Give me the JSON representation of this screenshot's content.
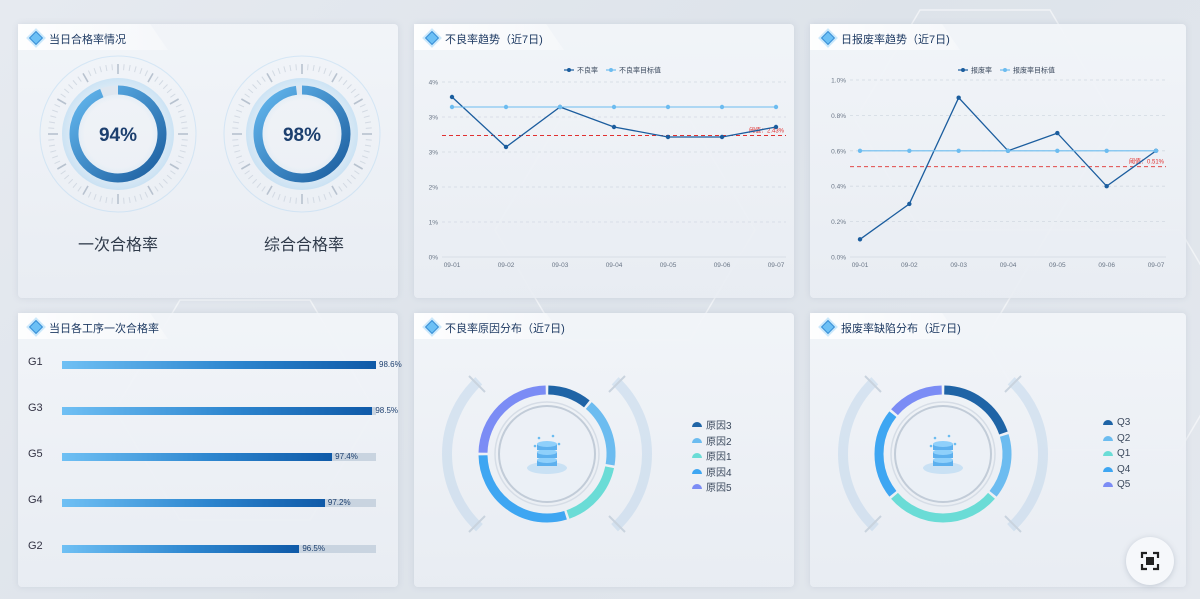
{
  "colors": {
    "dark_blue": "#1b5d9e",
    "light_blue": "#6cbcf0",
    "threshold_red": "#e03030",
    "pie": [
      "#1f64a6",
      "#6cbcf0",
      "#6adcd6",
      "#3ea6f2",
      "#7b8cf5"
    ]
  },
  "panels": {
    "pass_rate": {
      "title": "当日合格率情况",
      "gauges": [
        {
          "value_text": "94%",
          "value": 94,
          "label": "一次合格率"
        },
        {
          "value_text": "98%",
          "value": 98,
          "label": "综合合格率"
        }
      ]
    },
    "defect_trend": {
      "title": "不良率趋势（近7日)"
    },
    "scrap_trend": {
      "title": "日报废率趋势（近7日)"
    },
    "process_pass": {
      "title": "当日各工序一次合格率"
    },
    "defect_cause": {
      "title": "不良率原因分布（近7日)"
    },
    "scrap_defect": {
      "title": "报废率缺陷分布（近7日)"
    }
  },
  "chart_data": [
    {
      "type": "line",
      "x": [
        "09-01",
        "09-02",
        "09-03",
        "09-04",
        "09-05",
        "09-06",
        "09-07"
      ],
      "series": [
        {
          "name": "不良率",
          "values": [
            3.2,
            2.2,
            3.0,
            2.6,
            2.4,
            2.4,
            2.6
          ]
        },
        {
          "name": "不良率目标值",
          "values": [
            3.0,
            3.0,
            3.0,
            3.0,
            3.0,
            3.0,
            3.0
          ]
        }
      ],
      "yticks": [
        "0%",
        "1%",
        "2%",
        "3%",
        "3%",
        "4%"
      ],
      "ylim": [
        0,
        3.5
      ],
      "threshold": {
        "value": 2.43,
        "label": "阈值：2.43%"
      },
      "legend": "top-center"
    },
    {
      "type": "line",
      "x": [
        "09-01",
        "09-02",
        "09-03",
        "09-04",
        "09-05",
        "09-06",
        "09-07"
      ],
      "series": [
        {
          "name": "报废率",
          "values": [
            0.1,
            0.3,
            0.9,
            0.6,
            0.7,
            0.4,
            0.6
          ]
        },
        {
          "name": "报废率目标值",
          "values": [
            0.6,
            0.6,
            0.6,
            0.6,
            0.6,
            0.6,
            0.6
          ]
        }
      ],
      "yticks": [
        "0.0%",
        "0.2%",
        "0.4%",
        "0.6%",
        "0.8%",
        "1.0%"
      ],
      "ylim": [
        0,
        1.0
      ],
      "threshold": {
        "value": 0.51,
        "label": "阈值：0.51%"
      },
      "legend": "top-center"
    },
    {
      "type": "bar",
      "orientation": "horizontal",
      "categories": [
        "G1",
        "G3",
        "G5",
        "G4",
        "G2"
      ],
      "values": [
        98.6,
        98.5,
        97.4,
        97.2,
        96.5
      ],
      "value_labels": [
        "98.6%",
        "98.5%",
        "97.4%",
        "97.2%",
        "96.5%"
      ]
    },
    {
      "type": "pie",
      "categories": [
        "原因3",
        "原因2",
        "原因1",
        "原因4",
        "原因5"
      ],
      "values": [
        11,
        17,
        17,
        30,
        25
      ],
      "legend": "right"
    },
    {
      "type": "pie",
      "categories": [
        "Q3",
        "Q2",
        "Q1",
        "Q4",
        "Q5"
      ],
      "values": [
        20,
        16,
        28,
        22,
        14
      ],
      "legend": "right"
    }
  ]
}
